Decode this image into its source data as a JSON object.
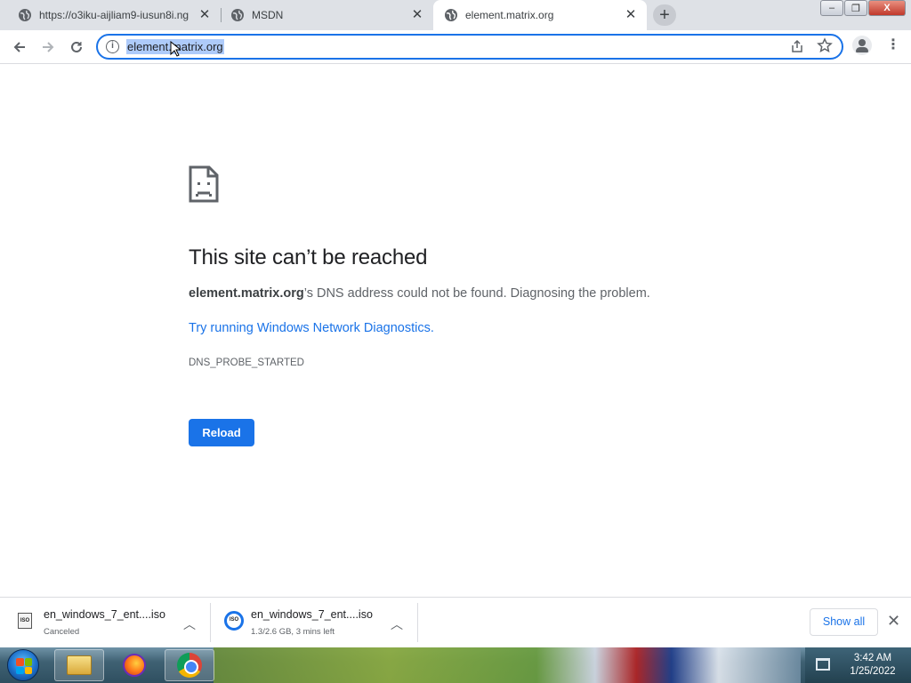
{
  "browser": {
    "tabs": [
      {
        "title": "https://o3iku-aijliam9-iusun8i.ng",
        "active": false
      },
      {
        "title": "MSDN",
        "active": false
      },
      {
        "title": "element.matrix.org",
        "active": true
      }
    ],
    "new_tab_label": "+",
    "close_label": "✕",
    "window_controls": {
      "minimize": "–",
      "restore": "❐",
      "close": "X"
    },
    "toolbar": {
      "back_icon": "arrow-left-icon",
      "forward_icon": "arrow-right-icon",
      "reload_icon": "reload-icon"
    },
    "omnibox": {
      "url": "element.matrix.org",
      "url_selected": true
    }
  },
  "error_page": {
    "title": "This site can’t be reached",
    "host": "element.matrix.org",
    "message_suffix": "’s DNS address could not be found. Diagnosing the problem.",
    "link_text": "Try running Windows Network Diagnostics.",
    "error_code": "DNS_PROBE_STARTED",
    "reload_label": "Reload"
  },
  "downloads": {
    "items": [
      {
        "name": "en_windows_7_ent....iso",
        "status": "Canceled",
        "icon_label": "ISO"
      },
      {
        "name": "en_windows_7_ent....iso",
        "status": "1.3/2.6 GB, 3 mins left",
        "icon_label": "ISO"
      }
    ],
    "show_all_label": "Show all",
    "close_label": "✕"
  },
  "taskbar": {
    "clock_time": "3:42 AM",
    "clock_date": "1/25/2022"
  },
  "colors": {
    "accent": "#1a73e8",
    "tab_strip": "#dee1e6",
    "selection": "#aecbfa"
  }
}
